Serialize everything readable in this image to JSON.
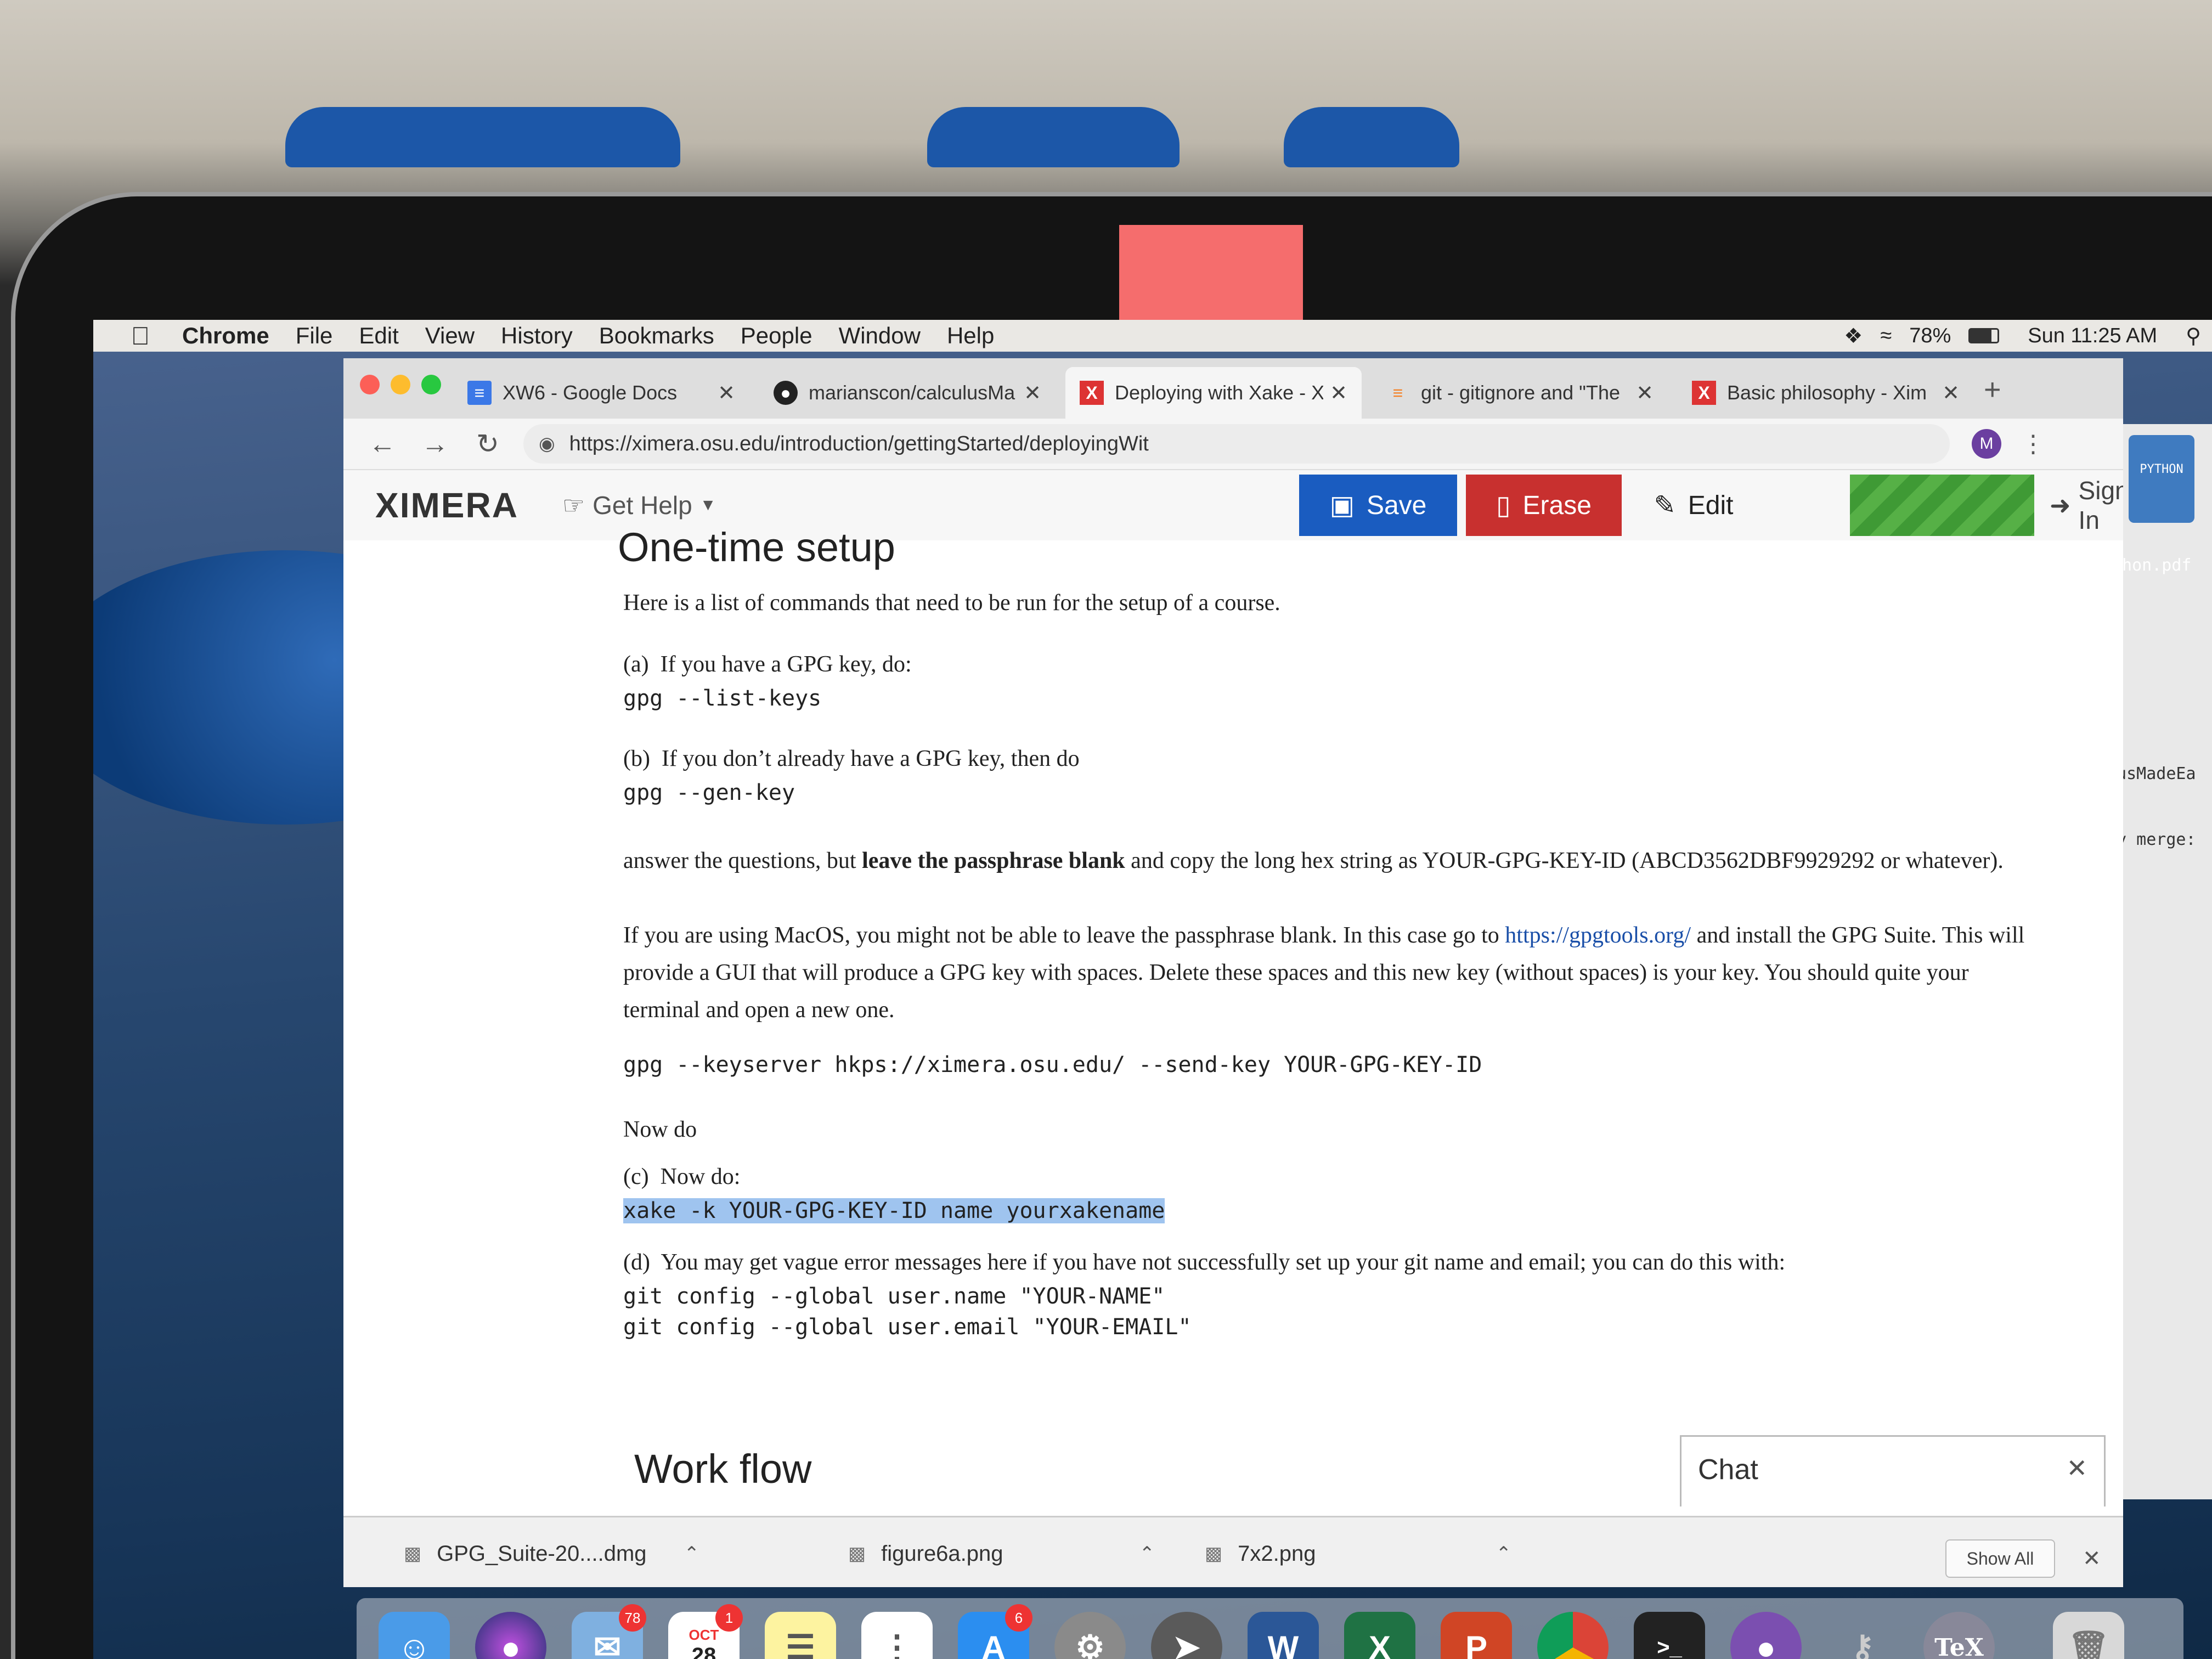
{
  "menubar": {
    "apple_icon": "apple-icon",
    "items": [
      "Chrome",
      "File",
      "Edit",
      "View",
      "History",
      "Bookmarks",
      "People",
      "Window",
      "Help"
    ],
    "battery": "78%",
    "clock": "Sun 11:25 AM"
  },
  "tabs": [
    {
      "title": "XW6 - Google Docs",
      "icon": "google-docs-icon"
    },
    {
      "title": "marianscon/calculusMa",
      "icon": "github-icon"
    },
    {
      "title": "Deploying with Xake - X",
      "icon": "ximera-icon"
    },
    {
      "title": "git - gitignore and \"The",
      "icon": "stackoverflow-icon"
    },
    {
      "title": "Basic philosophy - Xim",
      "icon": "ximera-icon"
    }
  ],
  "address": {
    "url": "https://ximera.osu.edu/introduction/gettingStarted/deployingWit",
    "avatar_letter": "M"
  },
  "ximera_nav": {
    "logo": "XIMERA",
    "get_help": "Get Help",
    "save": "Save",
    "erase": "Erase",
    "edit": "Edit",
    "sign_in": "Sign In"
  },
  "content": {
    "heading1": "One-time setup",
    "intro": "Here is a list of commands that need to be run for the setup of a course.",
    "a_label": "(a)",
    "a_text": "If you have a GPG key, do:",
    "a_code": "gpg --list-keys",
    "b_label": "(b)",
    "b_text": "If you don’t already have a GPG key, then do",
    "b_code": "gpg --gen-key",
    "answer_pre": "answer the questions, but ",
    "answer_bold": "leave the passphrase blank",
    "answer_post": " and copy the long hex string as YOUR-GPG-KEY-ID (ABCD3562DBF9929292 or whatever).",
    "macos_pre": "If you are using MacOS, you might not be able to leave the passphrase blank. In this case go to ",
    "macos_link": "https://gpgtools.org/",
    "macos_post": " and install the GPG Suite. This will provide a GUI that will produce a GPG key with spaces. Delete these spaces and this new key (without spaces) is your key. You should quite your terminal and open a new one.",
    "keyserver_code": "gpg --keyserver hkps://ximera.osu.edu/ --send-key YOUR-GPG-KEY-ID",
    "now_do": "Now do",
    "c_label": "(c)",
    "c_text": "Now do:",
    "c_code": "xake -k YOUR-GPG-KEY-ID name yourxakename",
    "d_label": "(d)",
    "d_text": "You may get vague error messages here if you have not successfully set up your git name and email; you can do this with:",
    "d_code1": "git config --global user.name \"YOUR-NAME\"",
    "d_code2": "git config --global user.email \"YOUR-EMAIL\"",
    "heading2": "Work flow"
  },
  "chat": {
    "title": "Chat"
  },
  "downloads": {
    "items": [
      "GPG_Suite-20....dmg",
      "figure6a.png",
      "7x2.png"
    ],
    "show_all": "Show All"
  },
  "dock": {
    "badges": {
      "mail": "78",
      "calendar": "1",
      "appstore": "6"
    },
    "calendar_month": "OCT",
    "calendar_day": "28"
  },
  "right_panel": {
    "line1": "PYTHON",
    "line2": "thon.pdf",
    "line3": "lusMadeEa",
    "line4": "by merge:"
  },
  "colors": {
    "save": "#1a5cc0",
    "erase": "#c8302f",
    "highlight": "#9fc4ef",
    "link": "#1a4fa8"
  }
}
